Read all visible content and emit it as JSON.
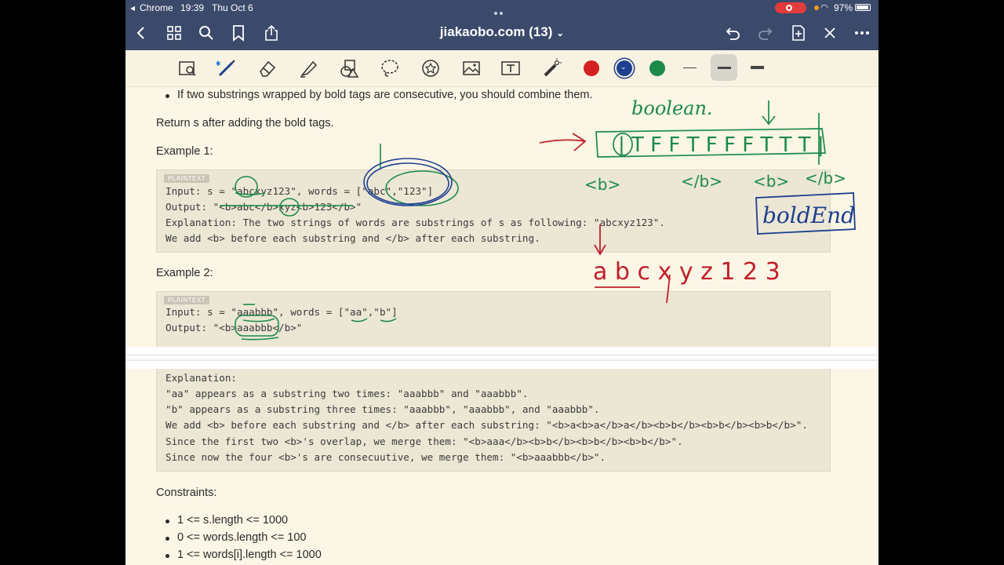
{
  "status": {
    "app": "Chrome",
    "time": "19:39",
    "date": "Thu Oct 6",
    "battery": "97%"
  },
  "nav": {
    "title": "jiakaobo.com (13)",
    "title_arrow": "⌄"
  },
  "toolbar": {
    "tools": [
      "zoom-pen-tool",
      "pen-tool",
      "eraser-tool",
      "highlighter-tool",
      "shapes-tool",
      "lasso-tool",
      "sticker-tool",
      "image-tool",
      "text-tool",
      "laser-pointer-tool"
    ],
    "colors": [
      "#d32020",
      "#1d3f8f",
      "#1b8a4a"
    ],
    "selected_color": "#1d3f8f",
    "stroke_sizes": [
      "thin",
      "medium",
      "thick"
    ],
    "selected_stroke": "medium"
  },
  "doc": {
    "bullet_top": "If two substrings wrapped by bold tags are consecutive, you should combine them.",
    "return_text": "Return s after adding the bold tags.",
    "example1_heading": "Example 1:",
    "example1_badge": "PLAINTEXT",
    "example1_lines": [
      "Input: s = \"abcxyz123\", words = [\"abc\",\"123\"]",
      "Output: \"<b>abc</b>xyz<b>123</b>\"",
      "Explanation: The two strings of words are substrings of s as following: \"abcxyz123\".",
      "We add <b> before each substring and </b> after each substring."
    ],
    "example2_heading": "Example 2:",
    "example2_badge": "PLAINTEXT",
    "example2_lines": [
      "Input: s = \"aaabbb\", words = [\"aa\",\"b\"]",
      "Output: \"<b>aaabbb</b>\""
    ],
    "example2_lines_cont": [
      "Explanation:",
      "\"aa\" appears as a substring two times: \"aaabbb\" and \"aaabbb\".",
      "\"b\" appears as a substring three times: \"aaabbb\", \"aaabbb\", and \"aaabbb\".",
      "We add <b> before each substring and </b> after each substring: \"<b>a<b>a</b>a</b><b>b</b><b>b</b><b>b</b>\".",
      "Since the first two <b>'s overlap, we merge them: \"<b>aaa</b><b>b</b><b>b</b><b>b</b>\".",
      "Since now the four <b>'s are consecuutive, we merge them: \"<b>aaabbb</b>\"."
    ],
    "constraints_heading": "Constraints:",
    "constraints": [
      "1 <= s.length <= 1000",
      "0 <= words.length <= 100",
      "1 <= words[i].length <= 1000"
    ]
  },
  "handwriting": {
    "label_boolean": "boolean.",
    "array": "| T F F T  F F F T T T |",
    "tags": [
      "<b>",
      "</b>",
      "<b>",
      "</b>"
    ],
    "boxed": "boldEnd",
    "string": "a b c x y z  1 2 3"
  }
}
